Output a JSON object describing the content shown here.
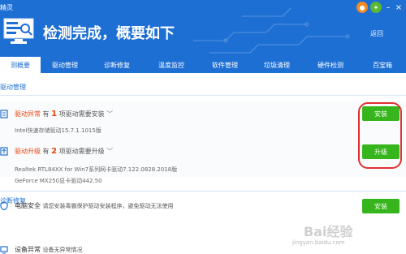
{
  "app": {
    "name": "精灵"
  },
  "window": {
    "controls": [
      "skin-icon",
      "game-icon",
      "minimize-icon",
      "close-icon"
    ]
  },
  "header": {
    "title": "检测完成，概要如下",
    "back_label": "返回"
  },
  "tabs": [
    {
      "label": "测概要",
      "active": true
    },
    {
      "label": "驱动管理"
    },
    {
      "label": "诊断修复"
    },
    {
      "label": "温度监控"
    },
    {
      "label": "软件管理"
    },
    {
      "label": "垃圾清理"
    },
    {
      "label": "硬件检测"
    },
    {
      "label": "百宝箱"
    }
  ],
  "driver_section": {
    "title": "驱动管理",
    "rows": [
      {
        "status": "驱动异常",
        "prefix": "有",
        "count": "1",
        "suffix": "项驱动需要安装",
        "details": [
          "Intel快速存储驱动15.7.1.1015版"
        ],
        "button": "安装"
      },
      {
        "status": "驱动升级",
        "prefix": "有",
        "count": "2",
        "suffix": "项驱动需要升级",
        "details": [
          "Realtek RTL84XX for Win7系列网卡驱动7.122.0828.2018版",
          "GeForce MX250显卡驱动442.50"
        ],
        "button": "升级"
      }
    ]
  },
  "diag_section": {
    "title": "诊断修复",
    "rows": [
      {
        "title": "电脑安全",
        "desc": "请您安装毒霸保护驱动安装程序，避免驱动无法使用",
        "button": "安装"
      },
      {
        "title": "设备异常",
        "desc": "设备无异常情况"
      }
    ]
  },
  "watermark": {
    "text": "jingyan.baidu.com",
    "logo": "Bai经验"
  },
  "colors": {
    "brand_blue": "#1e6fd4",
    "alert_red": "#e9430d",
    "button_green": "#36b51c",
    "annotation_red": "#e03131"
  }
}
